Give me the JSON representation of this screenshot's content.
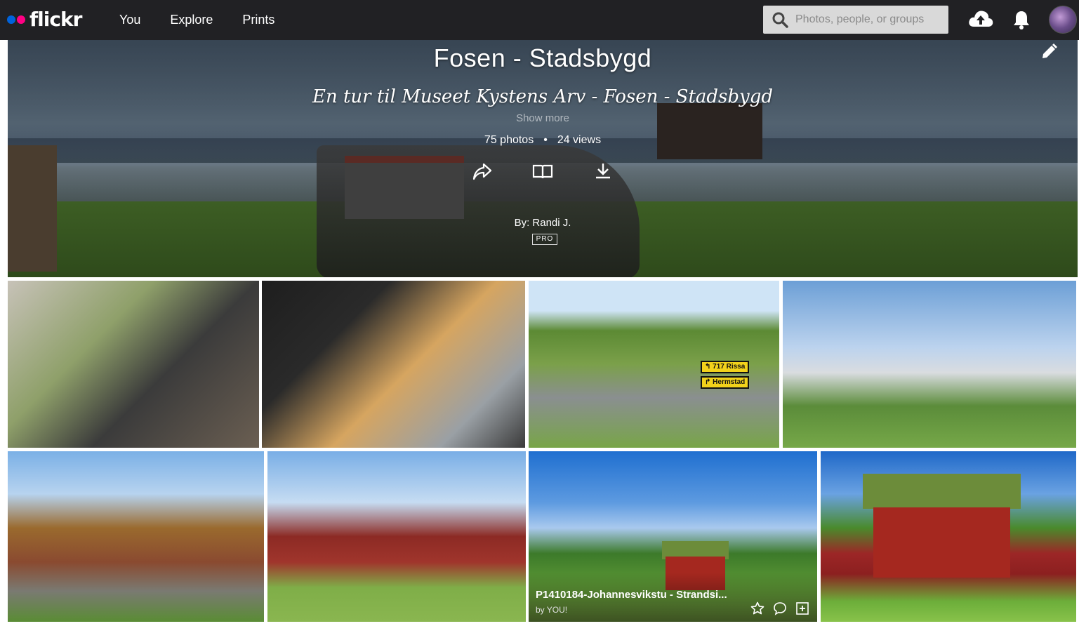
{
  "nav": {
    "logo_text": "flickr",
    "links": [
      "You",
      "Explore",
      "Prints"
    ],
    "search_placeholder": "Photos, people, or groups"
  },
  "album": {
    "title": "Fosen - Stadsbygd",
    "description": "En tur til Museet Kystens Arv - Fosen - Stadsbygd",
    "show_more": "Show more",
    "photos_count": "75 photos",
    "stats_separator": "•",
    "views_count": "24 views",
    "byline": "By: Randi J.",
    "badge": "PRO"
  },
  "signs": {
    "rissa": "↰ 717 Rissa",
    "hermstad": "↱ Hermstad"
  },
  "hover_photo": {
    "title": "P1410184-Johannesvikstu - Strandsi...",
    "by": "by YOU!"
  },
  "colors": {
    "topbar": "#212124",
    "flickr_blue": "#0063dc",
    "flickr_pink": "#ff0084"
  }
}
